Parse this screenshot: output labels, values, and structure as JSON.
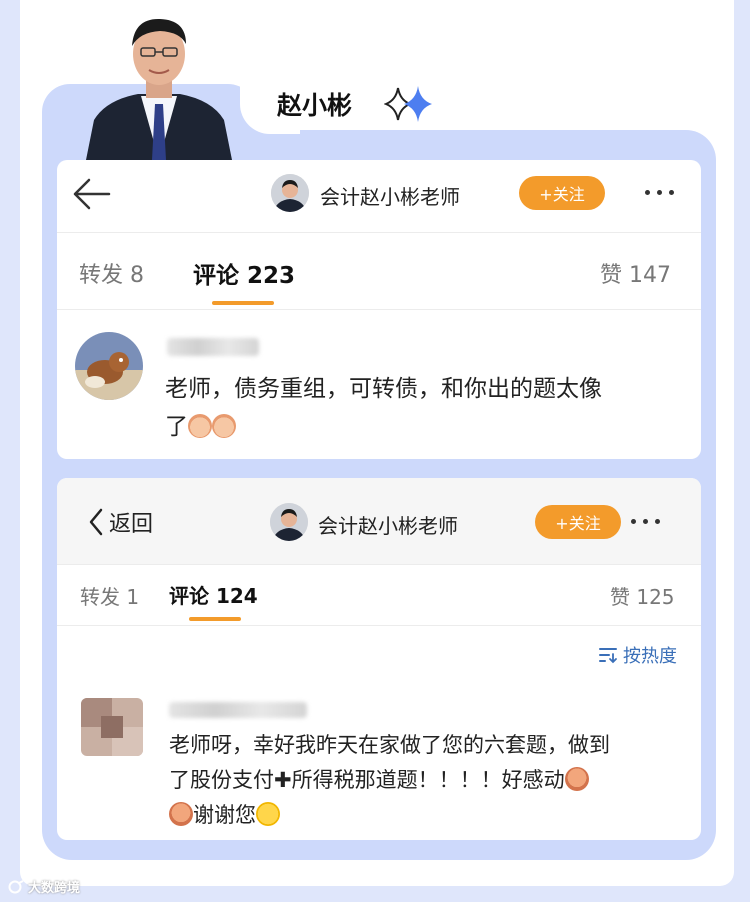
{
  "header": {
    "author_name": "赵小彬"
  },
  "post1": {
    "account_name": "会计赵小彬老师",
    "follow_label": "+关注",
    "tabs": {
      "repost": "转发 8",
      "comments": "评论 223",
      "likes": "赞 147"
    },
    "comment": {
      "line1": "老师，债务重组，可转债，和你出的题太像",
      "line2": "了"
    }
  },
  "post2": {
    "back_label": "返回",
    "account_name": "会计赵小彬老师",
    "follow_label": "+关注",
    "tabs": {
      "repost": "转发 1",
      "comments": "评论 124",
      "likes": "赞 125"
    },
    "sort_label": "按热度",
    "comment": {
      "line1": "老师呀，幸好我昨天在家做了您的六套题，做到",
      "line2a": "了股份支付",
      "line2_plus": "✚",
      "line2b": "所得税那道题！！！！好感动",
      "line3": "谢谢您"
    }
  },
  "watermark": {
    "text": "大数跨境"
  },
  "icons": {
    "back": "back-arrow-icon",
    "more": "more-dots-icon",
    "sort": "sort-icon",
    "sparkle": "sparkle-icon"
  },
  "colors": {
    "accent_orange": "#f39b2b",
    "frame_blue": "#cdd9fb",
    "link_blue": "#3a6fb8"
  }
}
